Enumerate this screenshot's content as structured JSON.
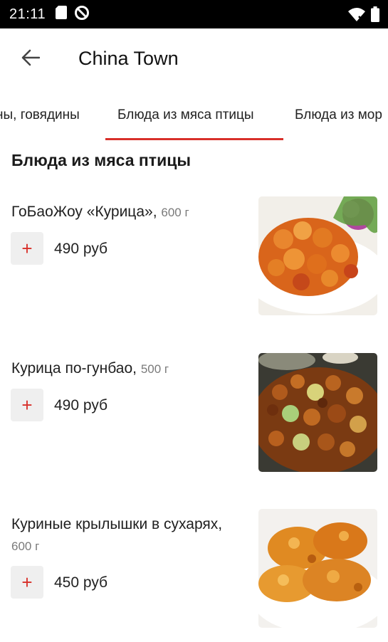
{
  "status_bar": {
    "time": "21:11",
    "left_icons": [
      "sd-card-icon",
      "do-not-disturb-icon"
    ],
    "right_icons": [
      "wifi-icon",
      "battery-icon"
    ]
  },
  "app_bar": {
    "back_icon": "arrow-left-icon",
    "title": "China Town"
  },
  "tabs": [
    {
      "label": "ны, говядины",
      "active": false
    },
    {
      "label": "Блюда из мяса птицы",
      "active": true
    },
    {
      "label": "Блюда из мор",
      "active": false
    }
  ],
  "colors": {
    "accent": "#d8302a",
    "status_bar": "#000000",
    "add_button_bg": "#efefef"
  },
  "section": {
    "title": "Блюда из мяса птицы"
  },
  "items": [
    {
      "name": "ГоБаоЖоу «Курица»,",
      "weight": "600 г",
      "add_label": "+",
      "price": "490 руб"
    },
    {
      "name": "Курица по-гунбао,",
      "weight": "500 г",
      "add_label": "+",
      "price": "490 руб"
    },
    {
      "name": "Куриные крылышки в сухарях,",
      "weight": "600 г",
      "add_label": "+",
      "price": "450 руб"
    }
  ]
}
